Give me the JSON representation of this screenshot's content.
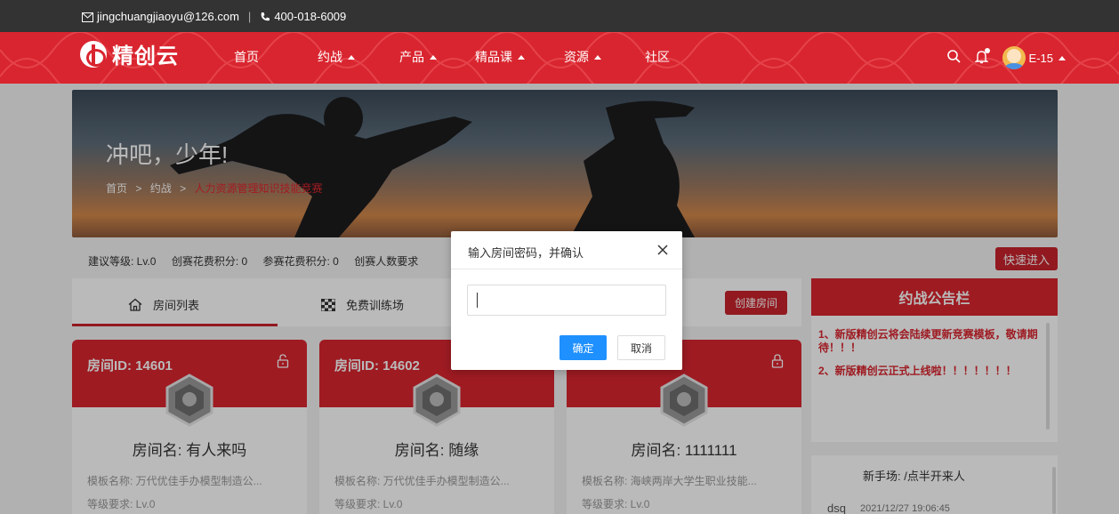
{
  "topbar": {
    "email": "jingchuangjiaoyu@126.com",
    "separator": "|",
    "phone": "400-018-6009"
  },
  "nav": {
    "logo_text": "精创云",
    "items": [
      {
        "label": "首页",
        "has_dropdown": false
      },
      {
        "label": "约战",
        "has_dropdown": true
      },
      {
        "label": "产品",
        "has_dropdown": true
      },
      {
        "label": "精品课",
        "has_dropdown": true
      },
      {
        "label": "资源",
        "has_dropdown": true
      },
      {
        "label": "社区",
        "has_dropdown": false
      }
    ],
    "user_name": "E-15"
  },
  "banner": {
    "title": "冲吧，少年!",
    "breadcrumb": {
      "home": "首页",
      "sep": ">",
      "section": "约战",
      "current": "人力资源管理知识技能竞赛"
    }
  },
  "infobar": {
    "level": "建议等级: Lv.0",
    "create_cost": "创赛花费积分: 0",
    "join_cost": "参赛花费积分: 0",
    "creator_count": "创赛人数要求"
  },
  "quick_enter_label": "快速进入",
  "tabs": [
    {
      "label": "房间列表"
    },
    {
      "label": "免费训练场"
    }
  ],
  "create_room_label": "创建房间",
  "rooms": [
    {
      "id": "房间ID: 14601",
      "name": "房间名: 有人来吗",
      "template": "模板名称: 万代优佳手办模型制造公...",
      "level": "等级要求: Lv.0"
    },
    {
      "id": "房间ID: 14602",
      "name": "房间名: 随缘",
      "template": "模板名称: 万代优佳手办模型制造公...",
      "level": "等级要求: Lv.0"
    },
    {
      "id": "",
      "name": "房间名: 1111111",
      "template": "模板名称: 海峡两岸大学生职业技能...",
      "level": "等级要求: Lv.0"
    }
  ],
  "notice": {
    "title": "约战公告栏",
    "items": [
      "1、新版精创云将会陆续更新竞赛模板，敬请期待！！！",
      "2、新版精创云正式上线啦！！！！！！！"
    ]
  },
  "newbie": {
    "title": "新手场: /点半开来人",
    "user": "dsq",
    "time": "2021/12/27 19:06:45"
  },
  "modal": {
    "title": "输入房间密码，并确认",
    "input_value": "",
    "input_placeholder": "",
    "confirm_label": "确定",
    "cancel_label": "取消"
  },
  "colors": {
    "brand_red": "#d9252f",
    "button_red": "#c9232c",
    "confirm_blue": "#1e90ff",
    "topbar": "#333333"
  }
}
